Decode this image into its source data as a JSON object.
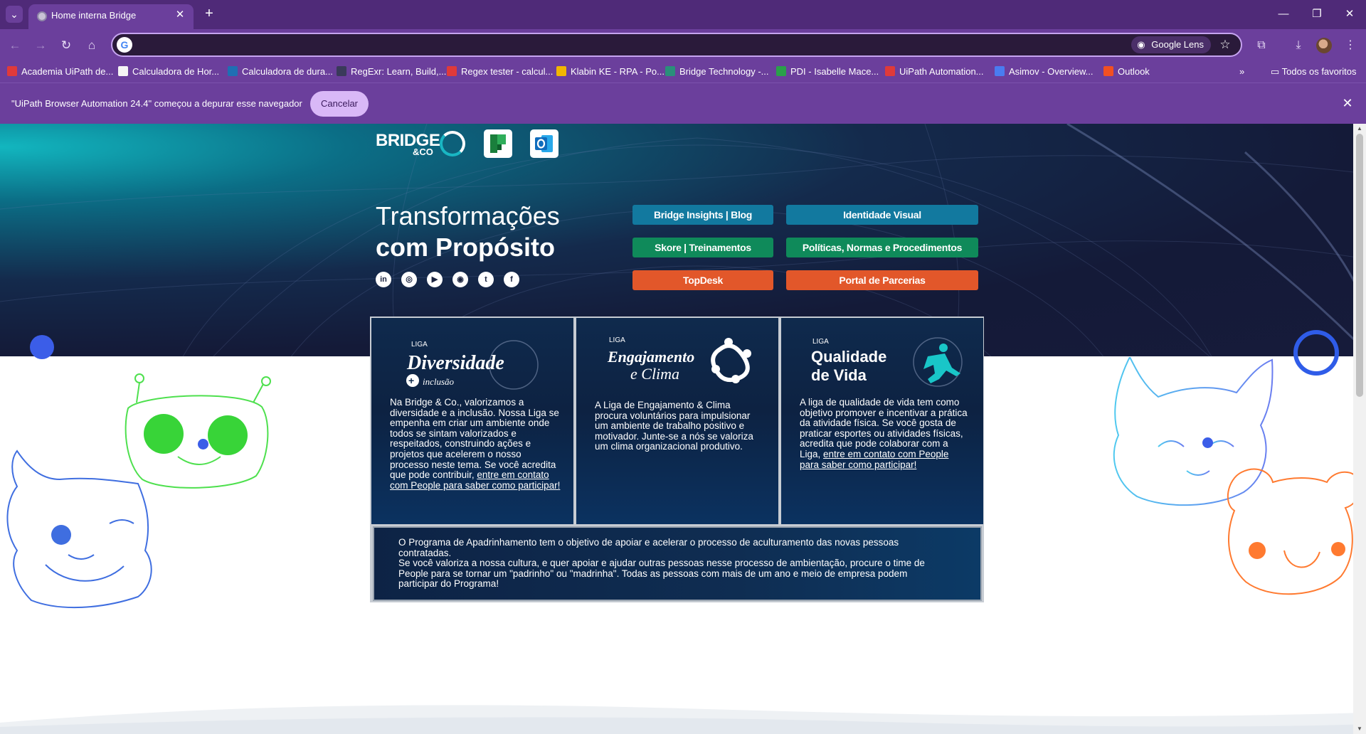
{
  "browser": {
    "tab": {
      "title": "Home interna Bridge",
      "close": "✕"
    },
    "new_tab": "+",
    "window_controls": {
      "minimize": "—",
      "restore": "❐",
      "close": "✕"
    },
    "nav": {
      "back": "←",
      "forward": "→",
      "reload": "↻",
      "home": "⌂"
    },
    "omnibox": {
      "value": "",
      "google_badge": "G",
      "lens_label": "Google Lens"
    },
    "toolbar_icons": {
      "star": "☆",
      "extensions": "⧉",
      "download": "⤓",
      "menu": "⋮"
    },
    "bookmarks": [
      {
        "label": "Academia UiPath de...",
        "icon_color": "#e03a3a"
      },
      {
        "label": "Calculadora de Hor...",
        "icon_color": "#f5f5f5"
      },
      {
        "label": "Calculadora de dura...",
        "icon_color": "#1f6fb3"
      },
      {
        "label": "RegExr: Learn, Build,...",
        "icon_color": "#3a3a5a"
      },
      {
        "label": "Regex tester - calcul...",
        "icon_color": "#e03a3a"
      },
      {
        "label": "Klabin KE - RPA - Po...",
        "icon_color": "#f2b600"
      },
      {
        "label": "Bridge Technology -...",
        "icon_color": "#2a8f7a"
      },
      {
        "label": "PDI - Isabelle Mace...",
        "icon_color": "#2aa04a"
      },
      {
        "label": "UiPath Automation...",
        "icon_color": "#e03a3a"
      },
      {
        "label": "Asimov - Overview...",
        "icon_color": "#4a7cf0"
      },
      {
        "label": "Outlook",
        "icon_color": "#f25022"
      }
    ],
    "bookmarks_overflow": "»",
    "all_bookmarks": "Todos os favoritos",
    "infobar": {
      "message": "\"UiPath Browser Automation 24.4\" começou a depurar esse navegador",
      "cancel": "Cancelar",
      "close": "✕"
    }
  },
  "hero": {
    "logo_word": "BRIDGE",
    "logo_sub": "&CO",
    "title_line1": "Transformações",
    "title_line2": "com Propósito",
    "socials": [
      "in",
      "◎",
      "▶",
      "◉",
      "t",
      "f"
    ],
    "buttons": {
      "insights": "Bridge Insights | Blog",
      "identidade": "Identidade Visual",
      "skore": "Skore | Treinamentos",
      "politicas": "Políticas, Normas e Procedimentos",
      "topdesk": "TopDesk",
      "parcerias": "Portal de Parcerias"
    },
    "colors": {
      "blue": "#12799f",
      "green": "#0f8a5a",
      "orange": "#e2572a"
    }
  },
  "cards": {
    "diversidade": {
      "liga": "LIGA",
      "title": "Diversidade",
      "sub": "inclusão",
      "text_pre": "Na Bridge & Co., valorizamos a diversidade e a inclusão. Nossa Liga se empenha em criar um ambiente onde todos se sintam valorizados e respeitados, construindo ações e projetos que acelerem o nosso processo neste tema. Se você acredita que pode contribuir, ",
      "link": "entre em contato com People para saber como participar!"
    },
    "engajamento": {
      "liga": "LIGA",
      "title1": "Engajamento",
      "title2": "e Clima",
      "text": "A Liga de Engajamento & Clima procura voluntários para impulsionar um ambiente de trabalho positivo e motivador. Junte-se a nós se valoriza um clima organizacional produtivo."
    },
    "qualidade": {
      "liga": "LIGA",
      "title1": "Qualidade",
      "title2": "de Vida",
      "text_pre": "A liga de qualidade de vida tem como objetivo promover e incentivar a prática da atividade física. Se você gosta de praticar esportes ou atividades físicas, acredita que pode colaborar com a Liga, ",
      "link": "entre em contato com People para saber como participar!"
    },
    "program": {
      "p1": "O Programa de Apadrinhamento tem o objetivo de apoiar e acelerar o processo de aculturamento das novas pessoas contratadas.",
      "p2": "Se você valoriza a nossa cultura, e quer apoiar e ajudar outras pessoas nesse processo de ambientação, procure o time de People para se tornar um \"padrinho\" ou \"madrinha\". Todas as pessoas com mais de um ano e meio de empresa podem participar do Programa!"
    }
  }
}
